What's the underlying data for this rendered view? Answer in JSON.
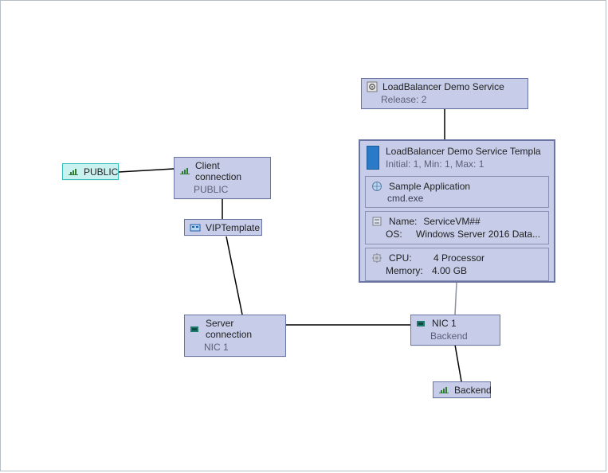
{
  "nodes": {
    "public": {
      "label": "PUBLIC"
    },
    "client_conn": {
      "label": "Client connection",
      "sub": "PUBLIC"
    },
    "vip": {
      "label": "VIPTemplate"
    },
    "server_conn": {
      "label": "Server connection",
      "sub": "NIC 1"
    },
    "nic1": {
      "label": "NIC 1",
      "sub": "Backend"
    },
    "backend": {
      "label": "Backend"
    },
    "service": {
      "label": "LoadBalancer Demo Service",
      "sub": "Release: 2"
    }
  },
  "template": {
    "title": "LoadBalancer Demo Service Templa",
    "subtitle": "Initial: 1, Min: 1, Max: 1",
    "app": {
      "name": "Sample Application",
      "cmd": "cmd.exe"
    },
    "vm": {
      "name_label": "Name:",
      "name": "ServiceVM##",
      "os_label": "OS:",
      "os": "Windows Server 2016 Data..."
    },
    "hw": {
      "cpu_label": "CPU:",
      "cpu": "4 Processor",
      "mem_label": "Memory:",
      "mem": "4.00 GB"
    }
  }
}
